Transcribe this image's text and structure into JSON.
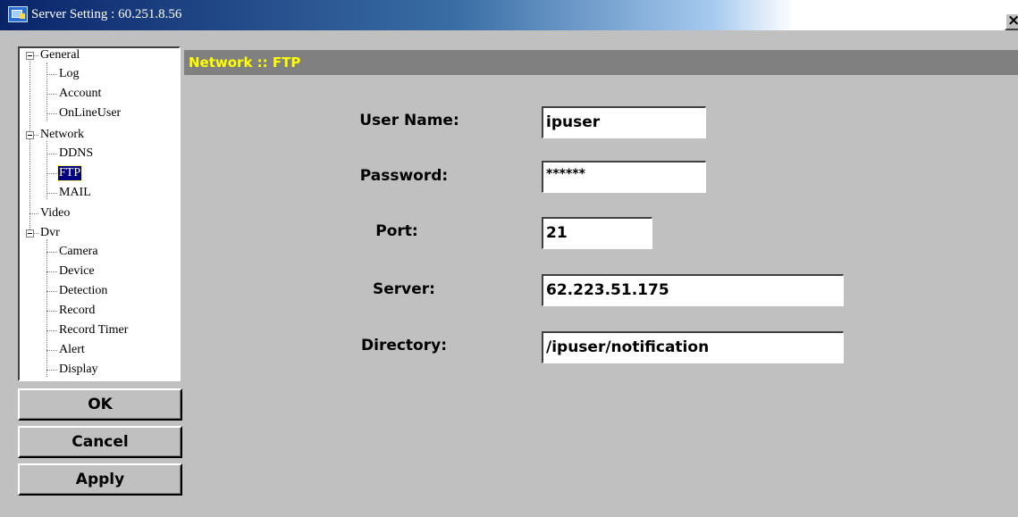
{
  "window": {
    "title": "Server Setting : 60.251.8.56",
    "close_label": "×"
  },
  "tree": {
    "items": [
      {
        "label": "General",
        "level": 0,
        "expanded": true
      },
      {
        "label": "Log",
        "level": 1
      },
      {
        "label": "Account",
        "level": 1
      },
      {
        "label": "OnLineUser",
        "level": 1
      },
      {
        "label": "Network",
        "level": 0,
        "expanded": true
      },
      {
        "label": "DDNS",
        "level": 1
      },
      {
        "label": "FTP",
        "level": 1,
        "selected": true
      },
      {
        "label": "MAIL",
        "level": 1
      },
      {
        "label": "Video",
        "level": 0
      },
      {
        "label": "Dvr",
        "level": 0,
        "expanded": true
      },
      {
        "label": "Camera",
        "level": 1
      },
      {
        "label": "Device",
        "level": 1
      },
      {
        "label": "Detection",
        "level": 1
      },
      {
        "label": "Record",
        "level": 1
      },
      {
        "label": "Record Timer",
        "level": 1
      },
      {
        "label": "Alert",
        "level": 1
      },
      {
        "label": "Display",
        "level": 1
      }
    ]
  },
  "buttons": {
    "ok": "OK",
    "cancel": "Cancel",
    "apply": "Apply"
  },
  "content": {
    "header": "Network :: FTP",
    "fields": {
      "username": {
        "label": "User Name:",
        "value": "ipuser"
      },
      "password": {
        "label": "Password:",
        "value": "******"
      },
      "port": {
        "label": "Port:",
        "value": "21"
      },
      "server": {
        "label": "Server:",
        "value": "62.223.51.175"
      },
      "directory": {
        "label": "Directory:",
        "value": "/ipuser/notification"
      }
    }
  },
  "colors": {
    "window_bg": "#c0c0c0",
    "header_bg": "#808080",
    "header_text": "#ffff00",
    "selection_bg": "#000080"
  }
}
